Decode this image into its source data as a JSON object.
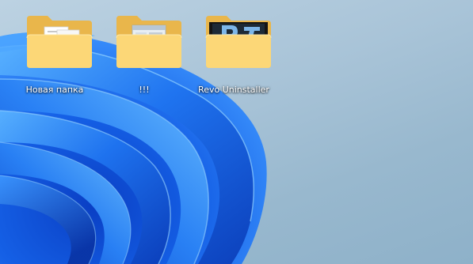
{
  "desktop": {
    "icons": [
      {
        "label": "Новая папка",
        "icon": "folder-icon-documents"
      },
      {
        "label": "!!!",
        "icon": "folder-icon-app-preview"
      },
      {
        "label": "Revo Uninstaller",
        "icon": "folder-icon-revo-preview"
      }
    ]
  },
  "colors": {
    "folder_back": "#e9b64b",
    "folder_front": "#fcd777",
    "wallpaper_blue": "#1461e0",
    "background": "#a9c4d8"
  }
}
